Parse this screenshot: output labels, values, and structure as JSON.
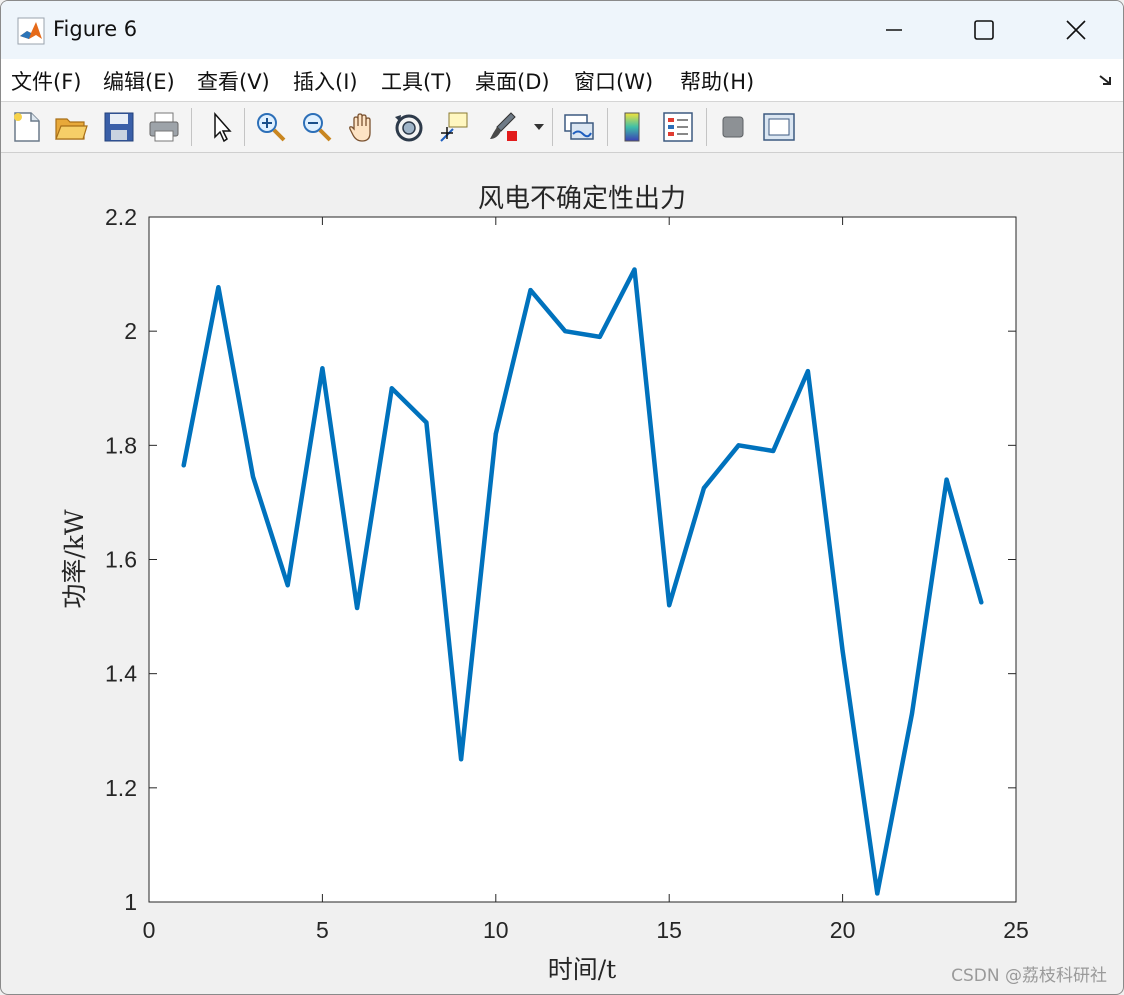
{
  "window": {
    "title": "Figure 6"
  },
  "menu": {
    "items": [
      {
        "id": "file",
        "label": "文件(F)"
      },
      {
        "id": "edit",
        "label": "编辑(E)"
      },
      {
        "id": "view",
        "label": "查看(V)"
      },
      {
        "id": "insert",
        "label": "插入(I)"
      },
      {
        "id": "tools",
        "label": "工具(T)"
      },
      {
        "id": "desktop",
        "label": "桌面(D)"
      },
      {
        "id": "window",
        "label": "窗口(W)"
      },
      {
        "id": "help",
        "label": "帮助(H)"
      }
    ]
  },
  "toolbar": {
    "icons": [
      "new-figure-icon",
      "open-file-icon",
      "save-icon",
      "print-icon",
      "select-arrow-icon",
      "zoom-in-icon",
      "zoom-out-icon",
      "pan-hand-icon",
      "rotate-3d-icon",
      "data-cursor-icon",
      "brush-icon",
      "link-plot-icon",
      "colorbar-icon",
      "legend-icon",
      "hide-plot-tools-icon",
      "show-plot-tools-icon"
    ]
  },
  "colors": {
    "line": "#0072BD",
    "axes_bg": "#ffffff",
    "figure_bg": "#f0f0f0"
  },
  "chart_data": {
    "type": "line",
    "title": "风电不确定性出力",
    "xlabel": "时间/t",
    "ylabel": "功率/kW",
    "xlim": [
      0,
      25
    ],
    "ylim": [
      1,
      2.2
    ],
    "xticks": [
      0,
      5,
      10,
      15,
      20,
      25
    ],
    "yticks": [
      1,
      1.2,
      1.4,
      1.6,
      1.8,
      2,
      2.2
    ],
    "xtick_labels": [
      "0",
      "5",
      "10",
      "15",
      "20",
      "25"
    ],
    "ytick_labels": [
      "1",
      "1.2",
      "1.4",
      "1.6",
      "1.8",
      "2",
      "2.2"
    ],
    "grid": false,
    "series": [
      {
        "x": [
          1,
          2,
          3,
          4,
          5,
          6,
          7,
          8,
          9,
          10,
          11,
          12,
          13,
          14,
          15,
          16,
          17,
          18,
          19,
          20,
          21,
          22,
          23,
          24
        ],
        "y": [
          1.765,
          2.077,
          1.745,
          1.555,
          1.935,
          1.515,
          1.9,
          1.84,
          1.25,
          1.82,
          2.072,
          2.0,
          1.99,
          2.108,
          1.52,
          1.725,
          1.8,
          1.79,
          1.93,
          1.44,
          1.015,
          1.33,
          1.74,
          1.525
        ]
      }
    ]
  },
  "watermark": "CSDN @荔枝科研社"
}
